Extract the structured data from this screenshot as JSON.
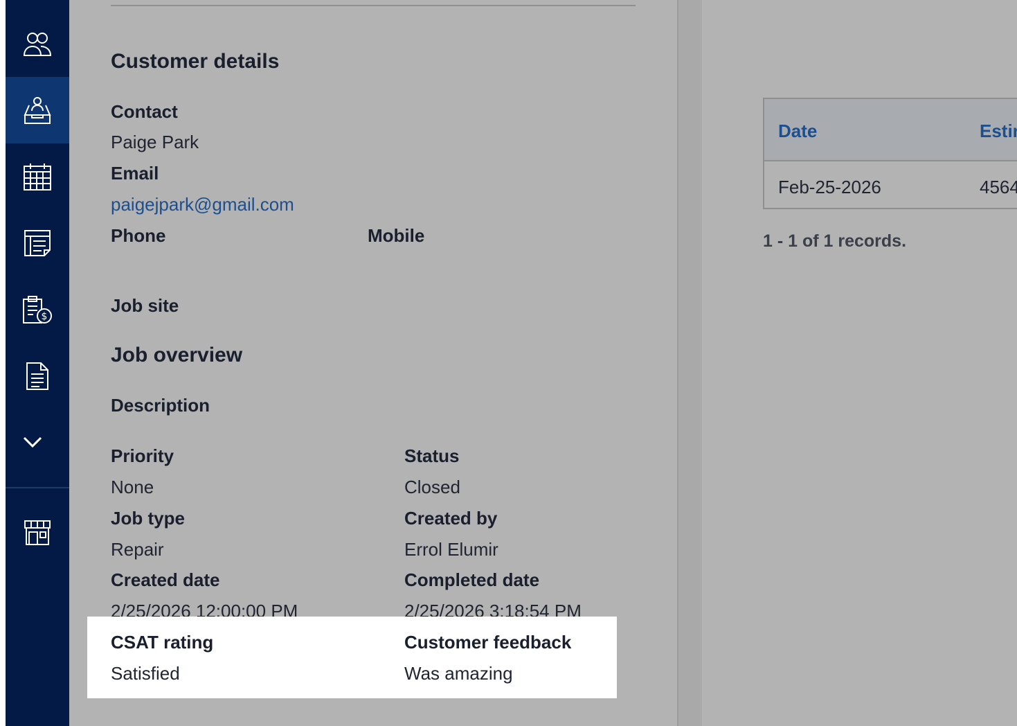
{
  "sidebar": {
    "items": [
      {
        "icon": "people-icon",
        "label": "Customers"
      },
      {
        "icon": "inbox-person-icon",
        "label": "Jobs"
      },
      {
        "icon": "calendar-icon",
        "label": "Calendar"
      },
      {
        "icon": "table-sheet-icon",
        "label": "Lists"
      },
      {
        "icon": "clipboard-dollar-icon",
        "label": "Invoices"
      },
      {
        "icon": "document-icon",
        "label": "Documents"
      },
      {
        "icon": "chevron-down-icon",
        "label": "More"
      },
      {
        "icon": "storefront-icon",
        "label": "Store"
      }
    ]
  },
  "customer": {
    "heading": "Customer details",
    "contact_label": "Contact",
    "contact_value": "Paige Park",
    "email_label": "Email",
    "email_value": "paigejpark@gmail.com",
    "phone_label": "Phone",
    "mobile_label": "Mobile",
    "job_site_label": "Job site"
  },
  "job": {
    "heading": "Job overview",
    "description_label": "Description",
    "priority_label": "Priority",
    "priority_value": "None",
    "status_label": "Status",
    "status_value": "Closed",
    "job_type_label": "Job type",
    "job_type_value": "Repair",
    "created_by_label": "Created by",
    "created_by_value": "Errol Elumir",
    "created_date_label": "Created date",
    "created_date_value": "2/25/2026 12:00:00 PM",
    "completed_date_label": "Completed date",
    "completed_date_value": "2/25/2026 3:18:54 PM",
    "csat_label": "CSAT rating",
    "csat_value": "Satisfied",
    "feedback_label": "Customer feedback",
    "feedback_value": "Was amazing"
  },
  "records_grid": {
    "columns": [
      "Date",
      "Estin"
    ],
    "rows": [
      [
        "Feb-25-2026",
        "4564"
      ]
    ],
    "pager_text": "1 - 1 of 1 records."
  },
  "colors": {
    "sidebar": "#031946",
    "sidebar_active": "#0e3670",
    "link": "#1d4f8f",
    "highlight": "#ffffff"
  }
}
